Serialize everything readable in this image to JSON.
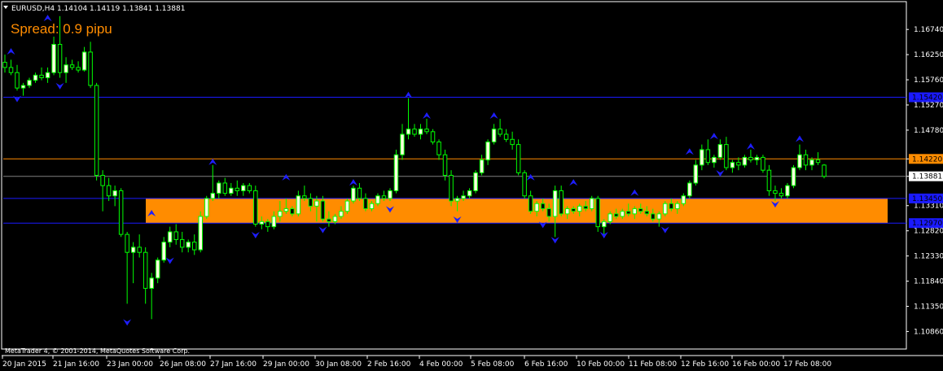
{
  "header": {
    "symbol_line": "EURUSD,H4  1.14104 1.14119 1.13841 1.13881"
  },
  "spread_label": "Spread: 0.9 pipu",
  "footer": "MetaTrader 4, © 2001-2014, MetaQuotes Software Corp.",
  "colors": {
    "background": "#000000",
    "grid": "#ffffff",
    "candle_bull": "#ffffe0",
    "candle_bear": "#000000",
    "wick": "#00ff00",
    "fractal": "#1e1eff",
    "zone": "#ff8c00",
    "level_line": "#1a1aff",
    "price_marker": "#ff8c00"
  },
  "chart_data": {
    "type": "candlestick",
    "symbol": "EURUSD",
    "timeframe": "H4",
    "ylim": [
      1.1055,
      1.1725
    ],
    "y_ticks": [
      "1.16740",
      "1.16250",
      "1.15760",
      "1.15270",
      "1.14780",
      "1.14220",
      "1.13881",
      "1.13310",
      "1.12820",
      "1.12330",
      "1.11840",
      "1.11350",
      "1.10860"
    ],
    "x_ticks": [
      "20 Jan 2015",
      "21 Jan 16:00",
      "23 Jan 00:00",
      "26 Jan 08:00",
      "27 Jan 16:00",
      "29 Jan 00:00",
      "30 Jan 08:00",
      "2 Feb 16:00",
      "4 Feb 00:00",
      "5 Feb 08:00",
      "6 Feb 16:00",
      "10 Feb 00:00",
      "11 Feb 08:00",
      "12 Feb 16:00",
      "16 Feb 00:00",
      "17 Feb 08:00"
    ],
    "horizontal_levels": [
      {
        "price": 1.1542,
        "label": "1.15420",
        "color": "#1a1aff"
      },
      {
        "price": 1.1422,
        "label": "1.14220",
        "color": "#ff8c00"
      },
      {
        "price": 1.1345,
        "label": "1.13450",
        "color": "#1a1aff"
      },
      {
        "price": 1.1297,
        "label": "1.12970",
        "color": "#1a1aff"
      }
    ],
    "current_price": {
      "price": 1.13881,
      "label": "1.13881"
    },
    "zone": {
      "from_price": 1.1345,
      "to_price": 1.1297
    },
    "candles": [
      [
        1.161,
        1.1625,
        1.159,
        1.16
      ],
      [
        1.16,
        1.1615,
        1.1585,
        1.159
      ],
      [
        1.159,
        1.1605,
        1.1555,
        1.156
      ],
      [
        1.156,
        1.157,
        1.1545,
        1.1565
      ],
      [
        1.1565,
        1.158,
        1.156,
        1.1575
      ],
      [
        1.1575,
        1.159,
        1.157,
        1.1585
      ],
      [
        1.1585,
        1.16,
        1.1575,
        1.158
      ],
      [
        1.158,
        1.16,
        1.157,
        1.159
      ],
      [
        1.159,
        1.166,
        1.1585,
        1.1645
      ],
      [
        1.1645,
        1.17,
        1.158,
        1.159
      ],
      [
        1.159,
        1.162,
        1.157,
        1.1605
      ],
      [
        1.1605,
        1.1615,
        1.1595,
        1.16
      ],
      [
        1.16,
        1.1612,
        1.159,
        1.1595
      ],
      [
        1.1595,
        1.164,
        1.1592,
        1.163
      ],
      [
        1.163,
        1.165,
        1.156,
        1.1565
      ],
      [
        1.1565,
        1.157,
        1.138,
        1.139
      ],
      [
        1.139,
        1.14,
        1.132,
        1.137
      ],
      [
        1.137,
        1.1385,
        1.134,
        1.135
      ],
      [
        1.135,
        1.137,
        1.133,
        1.136
      ],
      [
        1.136,
        1.1365,
        1.127,
        1.1275
      ],
      [
        1.1275,
        1.128,
        1.114,
        1.124
      ],
      [
        1.124,
        1.126,
        1.118,
        1.125
      ],
      [
        1.125,
        1.1275,
        1.123,
        1.124
      ],
      [
        1.124,
        1.125,
        1.114,
        1.117
      ],
      [
        1.117,
        1.12,
        1.111,
        1.119
      ],
      [
        1.119,
        1.123,
        1.118,
        1.1225
      ],
      [
        1.1225,
        1.127,
        1.122,
        1.126
      ],
      [
        1.126,
        1.129,
        1.125,
        1.128
      ],
      [
        1.128,
        1.1295,
        1.1255,
        1.1265
      ],
      [
        1.1265,
        1.128,
        1.124,
        1.125
      ],
      [
        1.125,
        1.1265,
        1.124,
        1.126
      ],
      [
        1.126,
        1.1275,
        1.1235,
        1.1245
      ],
      [
        1.1245,
        1.132,
        1.124,
        1.131
      ],
      [
        1.131,
        1.135,
        1.1305,
        1.1345
      ],
      [
        1.1345,
        1.141,
        1.134,
        1.1355
      ],
      [
        1.1355,
        1.138,
        1.1345,
        1.1375
      ],
      [
        1.1375,
        1.1385,
        1.135,
        1.1355
      ],
      [
        1.1355,
        1.1375,
        1.135,
        1.1365
      ],
      [
        1.1365,
        1.138,
        1.135,
        1.136
      ],
      [
        1.136,
        1.1375,
        1.135,
        1.137
      ],
      [
        1.137,
        1.1375,
        1.1355,
        1.136
      ],
      [
        1.136,
        1.137,
        1.129,
        1.1295
      ],
      [
        1.1295,
        1.131,
        1.1285,
        1.13
      ],
      [
        1.13,
        1.1305,
        1.128,
        1.129
      ],
      [
        1.129,
        1.132,
        1.1285,
        1.131
      ],
      [
        1.131,
        1.134,
        1.13,
        1.132
      ],
      [
        1.132,
        1.1345,
        1.1315,
        1.1325
      ],
      [
        1.1325,
        1.133,
        1.131,
        1.1315
      ],
      [
        1.1315,
        1.136,
        1.131,
        1.135
      ],
      [
        1.135,
        1.137,
        1.134,
        1.1345
      ],
      [
        1.1345,
        1.1355,
        1.132,
        1.133
      ],
      [
        1.133,
        1.135,
        1.13,
        1.134
      ],
      [
        1.134,
        1.135,
        1.13,
        1.1305
      ],
      [
        1.1305,
        1.132,
        1.129,
        1.13
      ],
      [
        1.13,
        1.1315,
        1.1295,
        1.131
      ],
      [
        1.131,
        1.133,
        1.1305,
        1.132
      ],
      [
        1.132,
        1.1345,
        1.1315,
        1.134
      ],
      [
        1.134,
        1.137,
        1.1335,
        1.1365
      ],
      [
        1.1365,
        1.1375,
        1.134,
        1.1345
      ],
      [
        1.1345,
        1.1355,
        1.132,
        1.1325
      ],
      [
        1.1325,
        1.134,
        1.132,
        1.1335
      ],
      [
        1.1335,
        1.1355,
        1.133,
        1.135
      ],
      [
        1.135,
        1.136,
        1.134,
        1.1345
      ],
      [
        1.1345,
        1.1365,
        1.134,
        1.136
      ],
      [
        1.136,
        1.144,
        1.1355,
        1.143
      ],
      [
        1.143,
        1.149,
        1.142,
        1.147
      ],
      [
        1.147,
        1.154,
        1.146,
        1.148
      ],
      [
        1.148,
        1.149,
        1.1465,
        1.147
      ],
      [
        1.147,
        1.149,
        1.146,
        1.148
      ],
      [
        1.148,
        1.15,
        1.147,
        1.1475
      ],
      [
        1.1475,
        1.148,
        1.145,
        1.1455
      ],
      [
        1.1455,
        1.146,
        1.142,
        1.143
      ],
      [
        1.143,
        1.144,
        1.138,
        1.139
      ],
      [
        1.139,
        1.14,
        1.133,
        1.134
      ],
      [
        1.134,
        1.135,
        1.132,
        1.1345
      ],
      [
        1.1345,
        1.136,
        1.134,
        1.135
      ],
      [
        1.135,
        1.1365,
        1.1345,
        1.136
      ],
      [
        1.136,
        1.14,
        1.1355,
        1.1395
      ],
      [
        1.1395,
        1.143,
        1.139,
        1.142
      ],
      [
        1.142,
        1.146,
        1.141,
        1.1455
      ],
      [
        1.1455,
        1.149,
        1.145,
        1.148
      ],
      [
        1.148,
        1.15,
        1.1465,
        1.147
      ],
      [
        1.147,
        1.148,
        1.1455,
        1.146
      ],
      [
        1.146,
        1.1475,
        1.144,
        1.145
      ],
      [
        1.145,
        1.146,
        1.139,
        1.1395
      ],
      [
        1.1395,
        1.14,
        1.1345,
        1.135
      ],
      [
        1.135,
        1.136,
        1.1315,
        1.132
      ],
      [
        1.132,
        1.134,
        1.131,
        1.1335
      ],
      [
        1.1335,
        1.1345,
        1.132,
        1.1325
      ],
      [
        1.1325,
        1.1335,
        1.13,
        1.131
      ],
      [
        1.131,
        1.137,
        1.127,
        1.136
      ],
      [
        1.136,
        1.137,
        1.131,
        1.1315
      ],
      [
        1.1315,
        1.133,
        1.1305,
        1.1325
      ],
      [
        1.1325,
        1.133,
        1.1315,
        1.132
      ],
      [
        1.132,
        1.1335,
        1.131,
        1.133
      ],
      [
        1.133,
        1.134,
        1.132,
        1.1325
      ],
      [
        1.1325,
        1.135,
        1.132,
        1.1345
      ],
      [
        1.1345,
        1.135,
        1.128,
        1.129
      ],
      [
        1.129,
        1.1305,
        1.1275,
        1.13
      ],
      [
        1.13,
        1.132,
        1.1295,
        1.1315
      ],
      [
        1.1315,
        1.1325,
        1.1305,
        1.131
      ],
      [
        1.131,
        1.1325,
        1.1305,
        1.132
      ],
      [
        1.132,
        1.1335,
        1.131,
        1.1315
      ],
      [
        1.1315,
        1.133,
        1.1305,
        1.1325
      ],
      [
        1.1325,
        1.1335,
        1.1315,
        1.132
      ],
      [
        1.132,
        1.133,
        1.131,
        1.1315
      ],
      [
        1.1315,
        1.1325,
        1.13,
        1.1305
      ],
      [
        1.1305,
        1.132,
        1.129,
        1.1315
      ],
      [
        1.1315,
        1.134,
        1.131,
        1.1335
      ],
      [
        1.1335,
        1.1345,
        1.132,
        1.1325
      ],
      [
        1.1325,
        1.134,
        1.1315,
        1.1335
      ],
      [
        1.1335,
        1.1355,
        1.133,
        1.135
      ],
      [
        1.135,
        1.138,
        1.1345,
        1.1375
      ],
      [
        1.1375,
        1.142,
        1.137,
        1.141
      ],
      [
        1.141,
        1.145,
        1.14,
        1.144
      ],
      [
        1.144,
        1.146,
        1.141,
        1.1415
      ],
      [
        1.1415,
        1.143,
        1.1405,
        1.1425
      ],
      [
        1.1425,
        1.146,
        1.142,
        1.145
      ],
      [
        1.145,
        1.1465,
        1.14,
        1.1405
      ],
      [
        1.1405,
        1.142,
        1.1395,
        1.1415
      ],
      [
        1.1415,
        1.1425,
        1.14,
        1.141
      ],
      [
        1.141,
        1.143,
        1.1405,
        1.1425
      ],
      [
        1.1425,
        1.144,
        1.1415,
        1.142
      ],
      [
        1.142,
        1.143,
        1.141,
        1.1425
      ],
      [
        1.1425,
        1.143,
        1.1395,
        1.14
      ],
      [
        1.14,
        1.141,
        1.135,
        1.136
      ],
      [
        1.136,
        1.137,
        1.134,
        1.1355
      ],
      [
        1.1355,
        1.1365,
        1.1345,
        1.135
      ],
      [
        1.135,
        1.1375,
        1.1345,
        1.137
      ],
      [
        1.137,
        1.141,
        1.1365,
        1.1405
      ],
      [
        1.1405,
        1.145,
        1.14,
        1.143
      ],
      [
        1.143,
        1.144,
        1.14,
        1.141
      ],
      [
        1.141,
        1.1425,
        1.14,
        1.142
      ],
      [
        1.142,
        1.1435,
        1.141,
        1.1415
      ],
      [
        1.141,
        1.1412,
        1.1384,
        1.1388
      ]
    ],
    "fractals": [
      {
        "i": 1,
        "dir": "up",
        "price": 1.1625
      },
      {
        "i": 2,
        "dir": "down",
        "price": 1.1545
      },
      {
        "i": 7,
        "dir": "up",
        "price": 1.169
      },
      {
        "i": 9,
        "dir": "down",
        "price": 1.157
      },
      {
        "i": 20,
        "dir": "down",
        "price": 1.111
      },
      {
        "i": 24,
        "dir": "up",
        "price": 1.131
      },
      {
        "i": 27,
        "dir": "down",
        "price": 1.123
      },
      {
        "i": 34,
        "dir": "up",
        "price": 1.141
      },
      {
        "i": 41,
        "dir": "down",
        "price": 1.128
      },
      {
        "i": 46,
        "dir": "up",
        "price": 1.138
      },
      {
        "i": 52,
        "dir": "down",
        "price": 1.129
      },
      {
        "i": 57,
        "dir": "up",
        "price": 1.137
      },
      {
        "i": 63,
        "dir": "down",
        "price": 1.133
      },
      {
        "i": 66,
        "dir": "up",
        "price": 1.154
      },
      {
        "i": 69,
        "dir": "up",
        "price": 1.15
      },
      {
        "i": 74,
        "dir": "down",
        "price": 1.131
      },
      {
        "i": 80,
        "dir": "up",
        "price": 1.15
      },
      {
        "i": 86,
        "dir": "up",
        "price": 1.138
      },
      {
        "i": 88,
        "dir": "down",
        "price": 1.13
      },
      {
        "i": 90,
        "dir": "down",
        "price": 1.127
      },
      {
        "i": 93,
        "dir": "up",
        "price": 1.137
      },
      {
        "i": 98,
        "dir": "down",
        "price": 1.128
      },
      {
        "i": 103,
        "dir": "up",
        "price": 1.135
      },
      {
        "i": 108,
        "dir": "down",
        "price": 1.129
      },
      {
        "i": 112,
        "dir": "up",
        "price": 1.143
      },
      {
        "i": 116,
        "dir": "up",
        "price": 1.146
      },
      {
        "i": 117,
        "dir": "down",
        "price": 1.14
      },
      {
        "i": 122,
        "dir": "up",
        "price": 1.144
      },
      {
        "i": 126,
        "dir": "down",
        "price": 1.134
      },
      {
        "i": 130,
        "dir": "up",
        "price": 1.1455
      }
    ]
  }
}
